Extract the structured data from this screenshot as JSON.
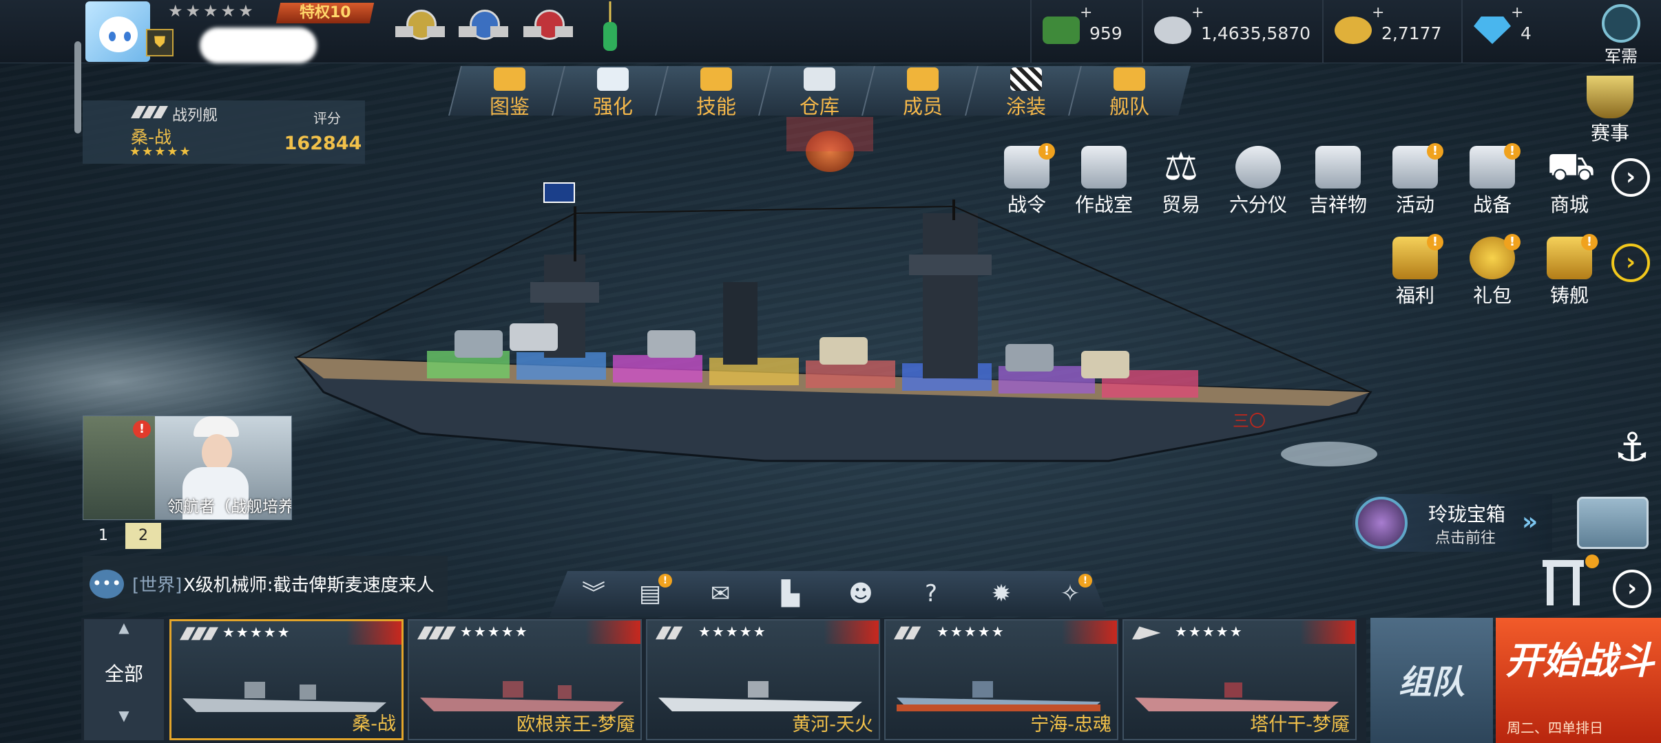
{
  "player": {
    "stars": "★★★★★",
    "privilege": "特权10",
    "name_hidden": true
  },
  "resources": [
    {
      "icon": "cash-icon",
      "value": "959",
      "color": "#3f8a3a"
    },
    {
      "icon": "silver-coins-icon",
      "value": "1,4635,5870",
      "color": "#c9cfd6"
    },
    {
      "icon": "gold-coins-icon",
      "value": "2,7177",
      "color": "#e0b03a"
    },
    {
      "icon": "diamond-icon",
      "value": "4",
      "color": "#49b6ee"
    }
  ],
  "supply": {
    "label": "军需"
  },
  "ship": {
    "type": "战列舰",
    "name": "桑-战",
    "stars": "★★★★★",
    "score_label": "评分",
    "score": "162844"
  },
  "nav": [
    {
      "label": "图鉴",
      "icon": "book-icon"
    },
    {
      "label": "强化",
      "icon": "upgrade-icon"
    },
    {
      "label": "技能",
      "icon": "skill-icon"
    },
    {
      "label": "仓库",
      "icon": "warehouse-icon"
    },
    {
      "label": "成员",
      "icon": "crew-icon"
    },
    {
      "label": "涂装",
      "icon": "paint-flag-icon"
    },
    {
      "label": "舰队",
      "icon": "fleet-flag-icon"
    }
  ],
  "event": {
    "label": "赛事"
  },
  "grid_row1": [
    {
      "label": "战令",
      "icon": "battle-pass-icon",
      "badge": "!"
    },
    {
      "label": "作战室",
      "icon": "war-room-icon",
      "badge": ""
    },
    {
      "label": "贸易",
      "icon": "scale-icon",
      "badge": ""
    },
    {
      "label": "六分仪",
      "icon": "sextant-icon",
      "badge": ""
    },
    {
      "label": "吉祥物",
      "icon": "mascot-icon",
      "badge": ""
    },
    {
      "label": "活动",
      "icon": "megaphone-icon",
      "badge": "!"
    },
    {
      "label": "战备",
      "icon": "book-stack-icon",
      "badge": "!"
    },
    {
      "label": "商城",
      "icon": "cart-icon",
      "badge": ""
    }
  ],
  "grid_row2": [
    {
      "label": "福利",
      "icon": "gift-box-icon",
      "badge": "!"
    },
    {
      "label": "礼包",
      "icon": "gold-pile-icon",
      "badge": "!"
    },
    {
      "label": "铸舰",
      "icon": "forge-icon",
      "badge": "!"
    }
  ],
  "crew_card": {
    "text": "领航者（战舰培养",
    "alert": "!"
  },
  "pager": {
    "p1": "1",
    "p2": "2"
  },
  "chat": {
    "channel": "[世界]",
    "message": "X级机械师:截击俾斯麦速度来人"
  },
  "toolbar": [
    {
      "icon": "collapse-icon",
      "glyph": "︾",
      "badge": ""
    },
    {
      "icon": "task-list-icon",
      "glyph": "▤",
      "badge": "!"
    },
    {
      "icon": "mail-icon",
      "glyph": "✉",
      "badge": ""
    },
    {
      "icon": "ranking-icon",
      "glyph": "▙",
      "badge": ""
    },
    {
      "icon": "friends-icon",
      "glyph": "☻",
      "badge": ""
    },
    {
      "icon": "help-icon",
      "glyph": "?",
      "badge": ""
    },
    {
      "icon": "settings-icon",
      "glyph": "✹",
      "badge": ""
    },
    {
      "icon": "hint-bulb-icon",
      "glyph": "✧",
      "badge": "!"
    }
  ],
  "treasure": {
    "title": "玲珑宝箱",
    "subtitle": "点击前往",
    "chevron": "»"
  },
  "all_button": {
    "label": "全部",
    "up": "▲",
    "down": "▼"
  },
  "ship_cards": [
    {
      "name": "桑-战",
      "stars": "★★★★★",
      "selected": true,
      "hull_color": "#b7c0c8",
      "deck_color": "#8c97a0"
    },
    {
      "name": "欧根亲王-梦魇",
      "stars": "★★★★★",
      "selected": false,
      "hull_color": "#b77a80",
      "deck_color": "#8b4a52"
    },
    {
      "name": "黄河-天火",
      "stars": "★★★★★",
      "selected": false,
      "hull_color": "#d7dde2",
      "deck_color": "#a2aab2"
    },
    {
      "name": "宁海-忠魂",
      "stars": "★★★★★",
      "selected": false,
      "hull_color": "#8ea7bf",
      "deck_color": "#c2502a"
    },
    {
      "name": "塔什干-梦魇",
      "stars": "★★★★★",
      "selected": false,
      "hull_color": "#c98a8e",
      "deck_color": "#8e3d46"
    }
  ],
  "team_button": {
    "label": "组队"
  },
  "start_button": {
    "label": "开始战斗",
    "subtitle": "周二、四单排日"
  },
  "arrows": {
    "right": "›"
  }
}
